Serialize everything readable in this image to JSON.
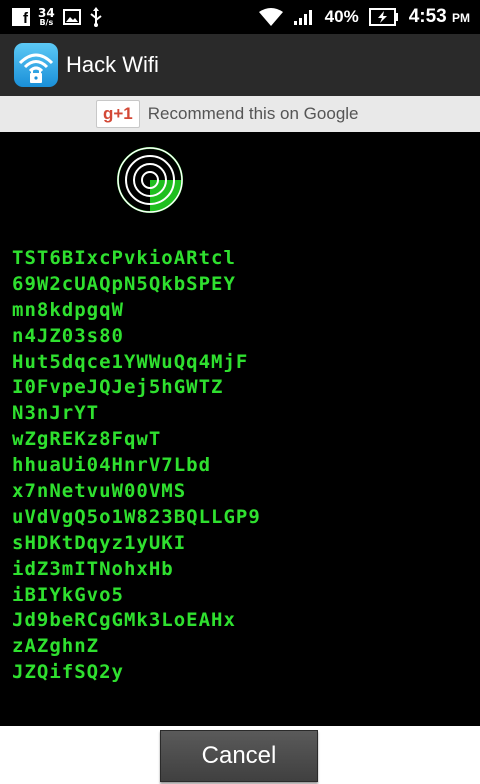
{
  "status_bar": {
    "net_speed_value": "34",
    "net_speed_unit": "B/s",
    "battery_percent": "40%",
    "time": "4:53",
    "time_suffix": "PM"
  },
  "app_bar": {
    "title": "Hack Wifi"
  },
  "google_plus": {
    "button_label": "g+1",
    "text": "Recommend this on Google"
  },
  "passwords": [
    "TST6BIxcPvkioARtcl",
    "69W2cUAQpN5QkbSPEY",
    "mn8kdpgqW",
    "n4JZ03s80",
    "Hut5dqce1YWWuQq4MjF",
    "I0FvpeJQJej5hGWTZ",
    "N3nJrYT",
    "wZgREKz8FqwT",
    "hhuaUi04HnrV7Lbd",
    "x7nNetvuW00VMS",
    "uVdVgQ5o1W823BQLLGP9",
    "sHDKtDqyz1yUKI",
    "idZ3mITNohxHb",
    "iBIYkGvo5",
    "Jd9beRCgGMk3LoEAHx",
    "zAZghnZ",
    "JZQifSQ2y"
  ],
  "actions": {
    "cancel_label": "Cancel"
  },
  "colors": {
    "terminal_green": "#2fe02f",
    "background": "#000000",
    "app_bar": "#2a2a2a"
  }
}
